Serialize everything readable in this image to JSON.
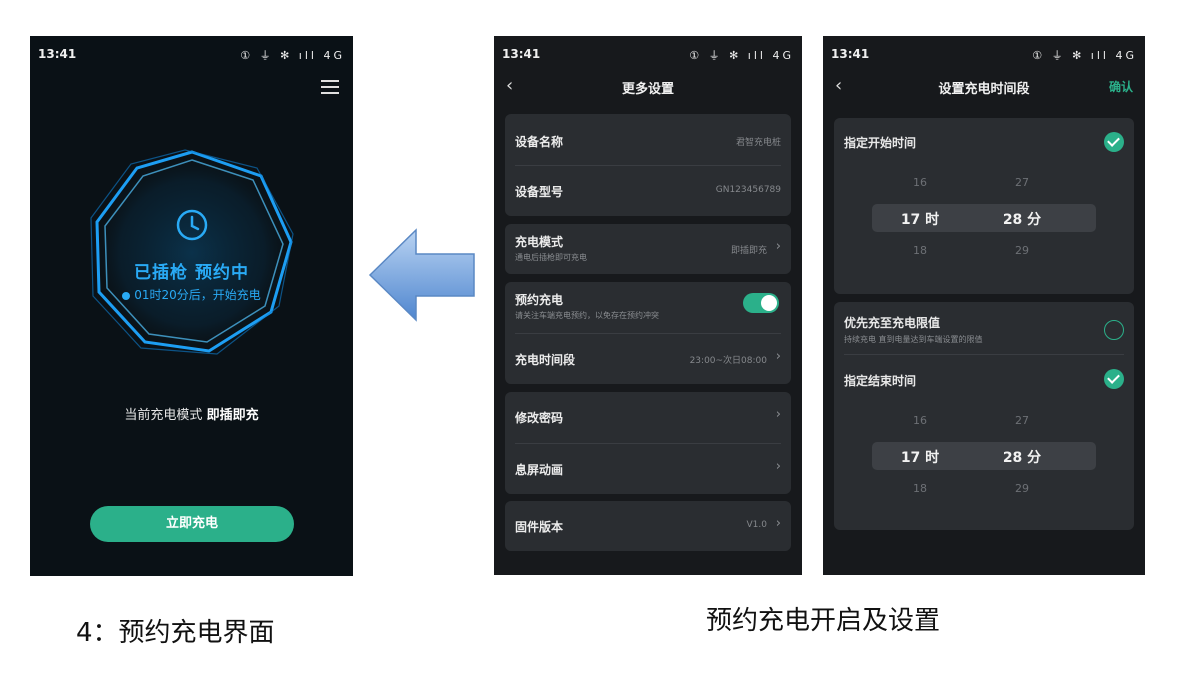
{
  "screen1": {
    "status": {
      "time": "13:41",
      "icons": "① ⏚ ✻ ıll 4G"
    },
    "status_main": "已插枪  预约中",
    "status_sub": "01时20分后，开始充电",
    "mode_prefix": "当前充电模式",
    "mode_value": "即插即充",
    "charge_button": "立即充电",
    "accent_color": "#29aaf5"
  },
  "screen2": {
    "status": {
      "time": "13:41",
      "icons": "① ⏚ ✻ ıll 4G"
    },
    "title": "更多设置",
    "rows": {
      "device_name": {
        "label": "设备名称",
        "value": "君智充电桩"
      },
      "device_model": {
        "label": "设备型号",
        "value": "GN123456789"
      },
      "charge_mode": {
        "label": "充电模式",
        "sub": "通电后插枪即可充电",
        "value": "即插即充"
      },
      "reservation": {
        "label": "预约充电",
        "sub": "请关注车端充电预约，以免存在预约冲突",
        "enabled": true
      },
      "time_period": {
        "label": "充电时间段",
        "value": "23:00~次日08:00"
      },
      "password": {
        "label": "修改密码"
      },
      "screen_anim": {
        "label": "息屏动画"
      },
      "firmware": {
        "label": "固件版本",
        "value": "V1.0"
      }
    }
  },
  "screen3": {
    "status": {
      "time": "13:41",
      "icons": "① ⏚ ✻ ıll 4G"
    },
    "title": "设置充电时间段",
    "confirm": "确认",
    "start_label": "指定开始时间",
    "start_picker": {
      "hour_prev": "16",
      "hour_sel": "17 时",
      "hour_next": "18",
      "min_prev": "27",
      "min_sel": "28 分",
      "min_next": "29"
    },
    "priority_label": "优先充至充电限值",
    "priority_sub": "持续充电  直到电量达到车端设置的限值",
    "end_label": "指定结束时间",
    "end_picker": {
      "hour_prev": "16",
      "hour_sel": "17 时",
      "hour_next": "18",
      "min_prev": "27",
      "min_sel": "28 分",
      "min_next": "29"
    },
    "accent_color": "#2bb08a"
  },
  "captions": {
    "left": "4：预约充电界面",
    "right": "预约充电开启及设置"
  }
}
